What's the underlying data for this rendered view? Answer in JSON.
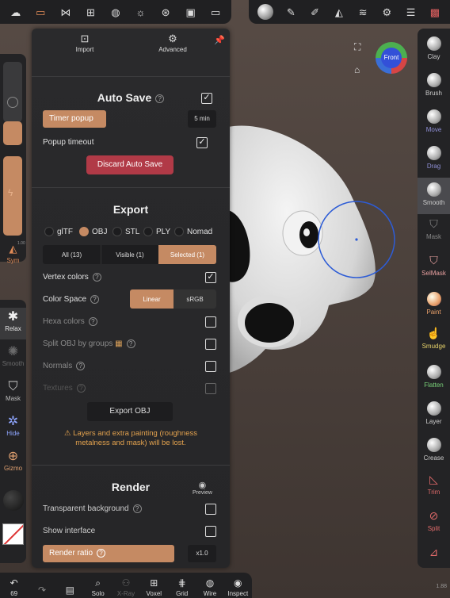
{
  "top_toolbar_left": {
    "icons": [
      "cloud-icon",
      "folder-icon",
      "share-nodes-icon",
      "layers-stack-icon",
      "globe-icon",
      "sun-icon",
      "aperture-icon",
      "image-icon",
      "video-icon"
    ]
  },
  "top_toolbar_right": {
    "icons": [
      "matcap-sphere-icon",
      "pencil-icon",
      "pen-icon",
      "symmetry-icon",
      "layers-icon",
      "settings-icon",
      "sliders-icon",
      "gift-icon"
    ]
  },
  "panel": {
    "tabs": [
      {
        "label": "Import",
        "icon": "import-icon"
      },
      {
        "label": "Advanced",
        "icon": "gear-icon"
      }
    ],
    "autosave": {
      "title": "Auto Save",
      "timer_label": "Timer popup",
      "timer_value": "5 min",
      "popup_timeout_label": "Popup timeout",
      "discard_label": "Discard Auto Save"
    },
    "export": {
      "title": "Export",
      "formats": [
        {
          "label": "glTF",
          "on": false
        },
        {
          "label": "OBJ",
          "on": true
        },
        {
          "label": "STL",
          "on": false
        },
        {
          "label": "PLY",
          "on": false
        },
        {
          "label": "Nomad",
          "on": false
        }
      ],
      "filter": [
        {
          "label": "All (13)",
          "on": false
        },
        {
          "label": "Visible (1)",
          "on": false
        },
        {
          "label": "Selected (1)",
          "on": true
        }
      ],
      "vertex_colors": "Vertex colors",
      "color_space": "Color Space",
      "color_space_options": [
        "Linear",
        "sRGB"
      ],
      "hexa_colors": "Hexa colors",
      "split_obj": "Split OBJ by groups",
      "normals": "Normals",
      "textures": "Textures",
      "export_button": "Export OBJ",
      "warning_line1": "Layers and extra painting (roughness",
      "warning_line2": "metalness and mask) will be lost."
    },
    "render": {
      "title": "Render",
      "preview_label": "Preview",
      "transparent_bg": "Transparent background",
      "show_interface": "Show interface",
      "render_ratio": "Render ratio",
      "ratio_value": "x1.0"
    }
  },
  "left_tools": {
    "sym_value": "1.00",
    "sym_label": "Sym",
    "relax": "Relax",
    "smooth": "Smooth",
    "mask": "Mask",
    "hide": "Hide",
    "gizmo": "Gizmo"
  },
  "right_tools": [
    {
      "label": "Clay",
      "color": "#cccccc"
    },
    {
      "label": "Brush",
      "color": "#cccccc"
    },
    {
      "label": "Move",
      "color": "#8f8fd6"
    },
    {
      "label": "Drag",
      "color": "#8f8fd6"
    },
    {
      "label": "Smooth",
      "color": "#cccccc"
    },
    {
      "label": "Mask",
      "color": "#888888"
    },
    {
      "label": "SelMask",
      "color": "#e8a0a0"
    },
    {
      "label": "Paint",
      "color": "#e8a06a"
    },
    {
      "label": "Smudge",
      "color": "#e8d36a"
    },
    {
      "label": "Flatten",
      "color": "#7ad27a"
    },
    {
      "label": "Layer",
      "color": "#cccccc"
    },
    {
      "label": "Crease",
      "color": "#cccccc"
    },
    {
      "label": "Trim",
      "color": "#e06a6a"
    },
    {
      "label": "Split",
      "color": "#e06a6a"
    }
  ],
  "bottom_toolbar": [
    {
      "label": "69",
      "icon": "undo-icon"
    },
    {
      "label": "",
      "icon": "redo-icon"
    },
    {
      "label": "",
      "icon": "document-icon"
    },
    {
      "label": "Solo",
      "icon": "search-icon"
    },
    {
      "label": "X-Ray",
      "icon": "xray-icon"
    },
    {
      "label": "Voxel",
      "icon": "voxel-icon"
    },
    {
      "label": "Grid",
      "icon": "grid-icon"
    },
    {
      "label": "Wire",
      "icon": "wire-icon"
    },
    {
      "label": "Inspect",
      "icon": "inspect-icon"
    }
  ],
  "viewport": {
    "cube_label": "Front",
    "version": "1.88"
  }
}
